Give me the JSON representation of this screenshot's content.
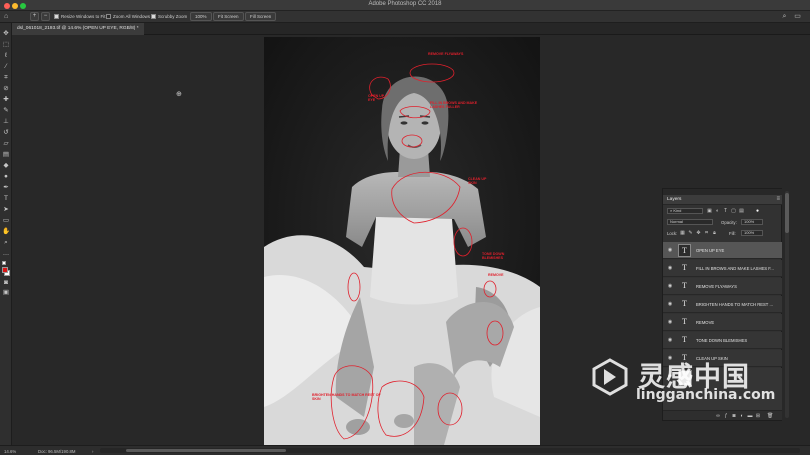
{
  "app": {
    "title": "Adobe Photoshop CC 2018"
  },
  "options_bar": {
    "resize_windows_label": "Resize Windows to Fit",
    "zoom_all_windows_label": "Zoom All Windows",
    "scrubby_zoom_label": "Scrubby Zoom",
    "zoom_value": "100%",
    "fit_screen_label": "Fit Screen",
    "fill_screen_label": "Fill Screen"
  },
  "document": {
    "tab_title": "dsl_061018_2193.tif @ 14.6% (OPEN UP EYE, RGB/8) *"
  },
  "status_bar": {
    "zoom": "14.6%",
    "doc_size": "Doc: 96.5M/190.8M"
  },
  "annotations": [
    "REMOVE FLYAWAYS",
    "FILL IN BROWS AND MAKE LASHES FULLER",
    "OPEN UP EYE",
    "CLEAN UP SKIN",
    "TONE DOWN BLEMISHES",
    "REMOVE",
    "BRIGHTEN HANDS TO MATCH REST OF SKIN"
  ],
  "layers_panel": {
    "title": "Layers",
    "filter_kind": "Kind",
    "blend_mode": "Normal",
    "opacity_label": "Opacity:",
    "opacity_value": "100%",
    "lock_label": "Lock:",
    "fill_label": "Fill:",
    "fill_value": "100%",
    "layers": [
      {
        "name": "OPEN UP EYE",
        "selected": true
      },
      {
        "name": "FILL IN BROWS AND MAKE LASHES F...",
        "selected": false
      },
      {
        "name": "REMOVE FLYAWAYS",
        "selected": false
      },
      {
        "name": "BRIGHTEN HANDS TO MATCH REST ...",
        "selected": false
      },
      {
        "name": "REMOVE",
        "selected": false
      },
      {
        "name": "TONE DOWN BLEMISHES",
        "selected": false
      },
      {
        "name": "CLEAN UP SKIN",
        "selected": false
      }
    ]
  },
  "watermark": {
    "chinese": "灵感中国",
    "url": "lingganchina.com"
  }
}
